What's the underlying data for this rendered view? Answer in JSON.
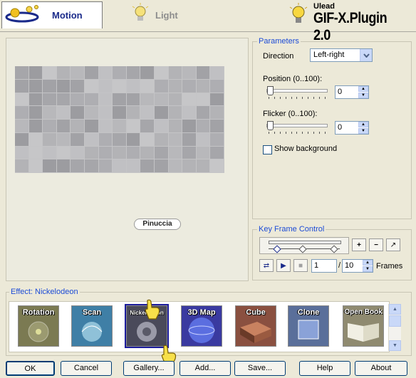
{
  "tabs": [
    {
      "label": "Motion",
      "active": true
    },
    {
      "label": "Light",
      "active": false
    }
  ],
  "brand": {
    "vendor": "Ulead",
    "product": "GIF-X.Plugin 2.0"
  },
  "preview": {
    "watermark": "Pinuccia"
  },
  "parameters": {
    "title": "Parameters",
    "direction_label": "Direction",
    "direction_value": "Left-right",
    "position_label": "Position (0..100):",
    "position_value": "0",
    "flicker_label": "Flicker (0..100):",
    "flicker_value": "0",
    "show_background_label": "Show background",
    "show_background_checked": false
  },
  "keyframe": {
    "title": "Key Frame Control",
    "current_frame": "1",
    "separator": "/",
    "total_frames": "10",
    "frames_label": "Frames"
  },
  "effects": {
    "title": "Effect: Nickelodeon",
    "items": [
      {
        "label": "Rotation",
        "selected": false,
        "color": "#7b7a52"
      },
      {
        "label": "Scan",
        "selected": false,
        "color": "#3f7fa6"
      },
      {
        "label": "Nickelodeon",
        "selected": true,
        "color": "#4a4a5a"
      },
      {
        "label": "3D Map",
        "selected": false,
        "color": "#3a3aa0"
      },
      {
        "label": "Cube",
        "selected": false,
        "color": "#8a5040"
      },
      {
        "label": "Clone",
        "selected": false,
        "color": "#5a6f9a"
      },
      {
        "label": "Open Book",
        "selected": false,
        "color": "#8f8a70"
      }
    ]
  },
  "buttons": {
    "ok": "OK",
    "cancel": "Cancel",
    "gallery": "Gallery...",
    "add": "Add...",
    "save": "Save...",
    "help": "Help",
    "about": "About"
  }
}
